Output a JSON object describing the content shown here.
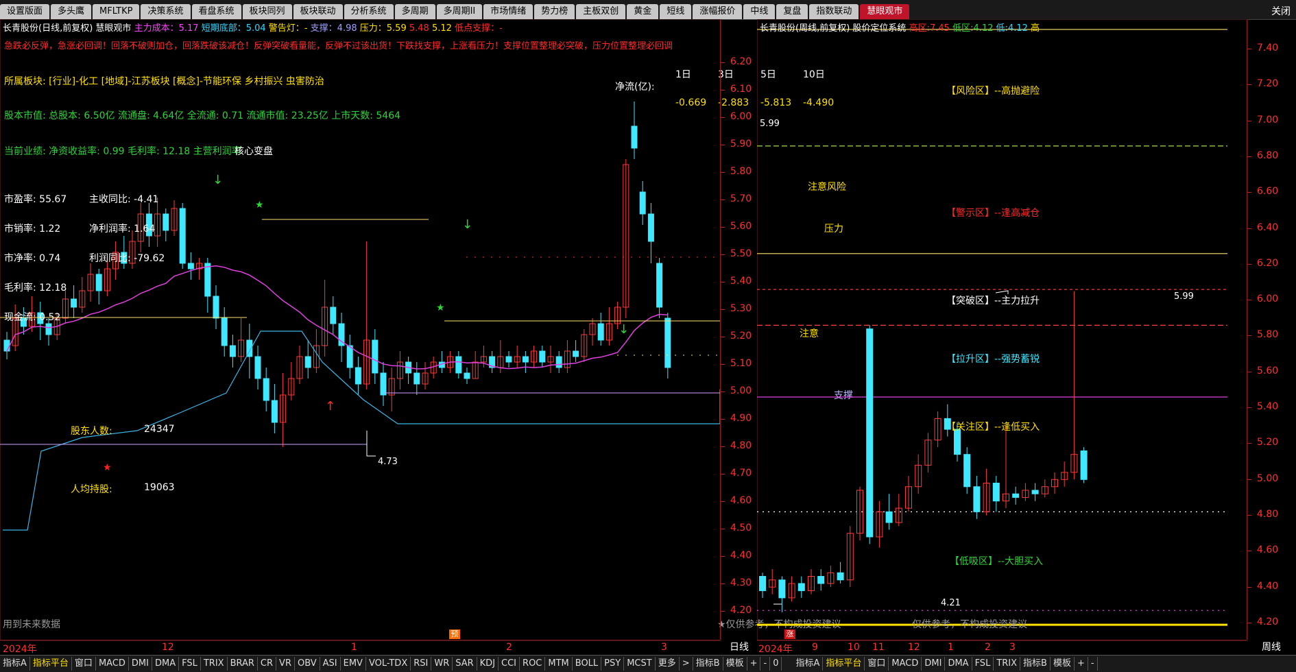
{
  "tabs": [
    "设置版面",
    "多头鹰",
    "MFLTKP",
    "决策系统",
    "看盘系统",
    "板块同列",
    "板块联动",
    "分析系统",
    "多周期",
    "多周期II",
    "市场情绪",
    "势力榜",
    "主板双创",
    "黄金",
    "短线",
    "涨幅报价",
    "中线",
    "复盘",
    "指数联动",
    "慧眼观市"
  ],
  "close_label": "关闭",
  "left_header": {
    "stock": "长青股份(日线,前复权)",
    "indicator": "慧眼观市",
    "main_cost_label": "主力成本：",
    "main_cost": "5.17",
    "short_bottom_label": "短期底部：",
    "short_bottom": "5.04",
    "alarm_label": "警告灯：",
    "alarm": "-",
    "support_label": "支撑：",
    "support": "4.98",
    "pressure_label": "压力：",
    "pressure": "5.59",
    "p2": "5.48",
    "p3": "5.12",
    "low_support_label": "低点支撑：",
    "low_support": "-"
  },
  "warning_line": "急跌必反弹，急涨必回调！回落不破则加仓，回落跌破该减仓！反弹突破看量能，反弹不过该出货！下跌找支撑，上涨看压力！支撑位置整理必突破，压力位置整理必回调",
  "sector": "所属板块: [行业]-化工 [地域]-江苏板块 [概念]-节能环保 乡村振兴 虫害防治",
  "capital": "股本市值: 总股本: 6.50亿 流通盘: 4.64亿 全流通: 0.71 流通市值: 23.25亿 上市天数: 5464",
  "performance": "当前业绩: 净资收益率: 0.99 毛利率: 12.18 主营利润率",
  "perf_overlay": "核心变盘",
  "fundamentals": [
    {
      "label": "市盈率:",
      "value": "55.67",
      "label2": "主收同比:",
      "value2": "-4.41"
    },
    {
      "label": "市销率:",
      "value": "1.22",
      "label2": "净利润率:",
      "value2": "1.64"
    },
    {
      "label": "市净率:",
      "value": "0.74",
      "label2": "利润同比:",
      "value2": "-79.62"
    },
    {
      "label": "毛利率:",
      "value": "12.18",
      "label2": "",
      "value2": ""
    },
    {
      "label": "现金流:",
      "value": "0.52",
      "label2": "",
      "value2": ""
    }
  ],
  "holders_label": "股东人数:",
  "holders": "24347",
  "per_holding_label": "人均持股:",
  "per_holding": "19063",
  "netflow": {
    "label": "净流(亿):",
    "periods": [
      "1日",
      "3日",
      "5日",
      "10日"
    ],
    "values": [
      "-0.669",
      "-2.883",
      "-5.813",
      "-4.490"
    ]
  },
  "left_notes": {
    "risk": "注意风险",
    "pressure": "压力",
    "attention": "注意",
    "support": "支撑",
    "high": "5.99",
    "low": "4.73",
    "future_data": "用到未来数据",
    "disclaimer": "★仅供参考，不构成投资建议",
    "bao_label": "预",
    "zhang_label": "涨"
  },
  "left_y_ticks": [
    "6.20",
    "6.10",
    "6.00",
    "5.90",
    "5.80",
    "5.70",
    "5.60",
    "5.50",
    "5.40",
    "5.30",
    "5.20",
    "5.10",
    "5.00",
    "4.90",
    "4.80",
    "4.70",
    "4.60",
    "4.50",
    "4.40",
    "4.30",
    "4.20"
  ],
  "left_dates": [
    "2024年",
    "12",
    "1",
    "2",
    "3"
  ],
  "left_period": "日线",
  "right_header": {
    "stock": "长青股份(周线,前复权)",
    "indicator": "股价定位系统",
    "high_label": "高区:",
    "high": "7.45",
    "low_label": "低区:",
    "low": "4.12",
    "low2_label": "低:",
    "low2": "4.12",
    "tail": "高"
  },
  "zones": [
    {
      "name": "【风险区】--高抛避险"
    },
    {
      "name": "【警示区】--逢高减仓"
    },
    {
      "name": "【突破区】--主力拉升"
    },
    {
      "name": "【拉升区】--强势蓄锐"
    },
    {
      "name": "【关注区】--逢低买入"
    },
    {
      "name": "【低吸区】--大胆买入"
    }
  ],
  "right_notes": {
    "high": "5.99",
    "low": "4.21",
    "disclaimer": "仅供参考，不构成投资建议"
  },
  "right_y_ticks": [
    "7.40",
    "7.20",
    "7.00",
    "6.80",
    "6.60",
    "6.40",
    "6.20",
    "6.00",
    "5.80",
    "5.60",
    "5.40",
    "5.20",
    "5.00",
    "4.80",
    "4.60",
    "4.40",
    "4.20"
  ],
  "right_dates": [
    "2024年",
    "9",
    "10",
    "11",
    "12",
    "1",
    "2",
    "3"
  ],
  "right_period": "周线",
  "bottom_left": [
    "指标A",
    "指标平台",
    "窗口",
    "MACD",
    "DMI",
    "DMA",
    "FSL",
    "TRIX",
    "BRAR",
    "CR",
    "VR",
    "OBV",
    "ASI",
    "EMV",
    "VOL-TDX",
    "RSI",
    "WR",
    "SAR",
    "KDJ",
    "CCI",
    "ROC",
    "MTM",
    "BOLL",
    "PSY",
    "MCST",
    "更多",
    ">",
    "指标B",
    "模板",
    "+",
    "-",
    "0"
  ],
  "bottom_right": [
    "指标A",
    "指标平台",
    "窗口",
    "MACD",
    "DMI",
    "DMA",
    "FSL",
    "TRIX",
    "指标B",
    "模板",
    "+",
    "-"
  ],
  "colors": {
    "up": "#ff3b3b",
    "down": "#3fe8ff",
    "ma": "#e040e0",
    "bg": "#000000"
  }
}
